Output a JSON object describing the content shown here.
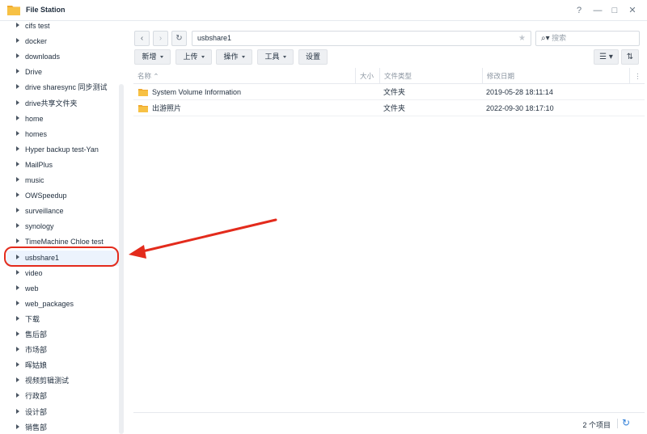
{
  "window": {
    "title": "File Station",
    "controls": {
      "help": "?",
      "minimize": "—",
      "maximize": "□",
      "close": "✕"
    }
  },
  "sidebar": {
    "items": [
      {
        "label": "cifs test"
      },
      {
        "label": "docker"
      },
      {
        "label": "downloads"
      },
      {
        "label": "Drive"
      },
      {
        "label": "drive sharesync 同步测试"
      },
      {
        "label": "drive共享文件夹"
      },
      {
        "label": "home"
      },
      {
        "label": "homes"
      },
      {
        "label": "Hyper backup test-Yan"
      },
      {
        "label": "MailPlus"
      },
      {
        "label": "music"
      },
      {
        "label": "OWSpeedup"
      },
      {
        "label": "surveillance"
      },
      {
        "label": "synology"
      },
      {
        "label": "TimeMachine Chloe test"
      },
      {
        "label": "usbshare1",
        "selected": true
      },
      {
        "label": "video"
      },
      {
        "label": "web"
      },
      {
        "label": "web_packages"
      },
      {
        "label": "下载"
      },
      {
        "label": "售后部"
      },
      {
        "label": "市场部"
      },
      {
        "label": "晖姑娘"
      },
      {
        "label": "视频剪辑测试"
      },
      {
        "label": "行政部"
      },
      {
        "label": "设计部"
      },
      {
        "label": "销售部"
      }
    ]
  },
  "nav": {
    "back_icon": "chevron-left-icon",
    "forward_icon": "chevron-right-icon",
    "refresh_icon": "refresh-icon",
    "path": "usbshare1",
    "search_placeholder": "搜索"
  },
  "toolbar": {
    "new_label": "新增",
    "upload_label": "上传",
    "action_label": "操作",
    "tools_label": "工具",
    "settings_label": "设置"
  },
  "table": {
    "columns": [
      "名称",
      "大小",
      "文件类型",
      "修改日期"
    ],
    "rows": [
      {
        "name": "System Volume Information",
        "size": "",
        "type": "文件夹",
        "modified": "2019-05-28 18:11:14"
      },
      {
        "name": "出游照片",
        "size": "",
        "type": "文件夹",
        "modified": "2022-09-30 18:17:10"
      }
    ]
  },
  "footer": {
    "item_count": "2 个项目"
  },
  "colors": {
    "accent": "#2f7ed8",
    "annotation_red": "#e32b1c",
    "folder_yellow": "#f7c144",
    "selected_bg": "#ecf3fd"
  }
}
